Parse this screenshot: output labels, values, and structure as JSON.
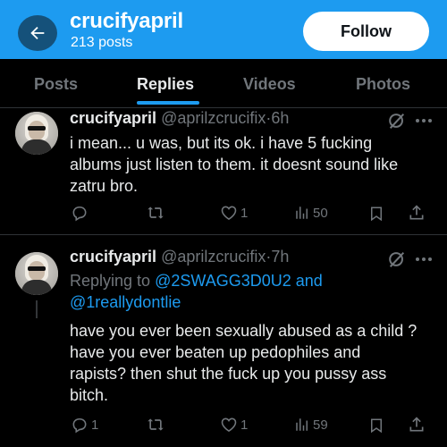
{
  "header": {
    "name": "crucifyapril",
    "post_count": "213 posts",
    "follow_label": "Follow"
  },
  "tabs": [
    {
      "label": "Posts",
      "active": false
    },
    {
      "label": "Replies",
      "active": true
    },
    {
      "label": "Videos",
      "active": false
    },
    {
      "label": "Photos",
      "active": false
    }
  ],
  "posts": [
    {
      "name": "crucifyapril",
      "handle": "@aprilzcrucifix",
      "time": "6h",
      "text_lines": [
        "i mean... u was, but its ok. i have 5 fucking",
        "albums just listen to them. it doesnt sound like",
        "zatru bro."
      ],
      "replies": "",
      "reposts": "",
      "likes": "1",
      "views": "50"
    },
    {
      "name": "crucifyapril",
      "handle": "@aprilzcrucifix",
      "time": "7h",
      "replying_prefix": "Replying to",
      "mention_1": "@2SWAGG3D0U2",
      "and_text": "and",
      "mention_2": "@1reallydontlie",
      "text_lines": [
        "have you ever been sexually abused as a child ?",
        "have you ever beaten up pedophiles and",
        "rapists? then shut the fuck up you pussy ass",
        "bitch."
      ],
      "replies": "1",
      "reposts": "",
      "likes": "1",
      "views": "59"
    }
  ],
  "separator": "·",
  "colors": {
    "accent": "#1d9bf0",
    "background": "#000000",
    "text": "#e7e9ea",
    "muted": "#71767b"
  },
  "icons": [
    "back-arrow-icon",
    "grok-icon",
    "more-icon",
    "reply-icon",
    "repost-icon",
    "like-icon",
    "views-icon",
    "bookmark-icon",
    "share-icon"
  ]
}
